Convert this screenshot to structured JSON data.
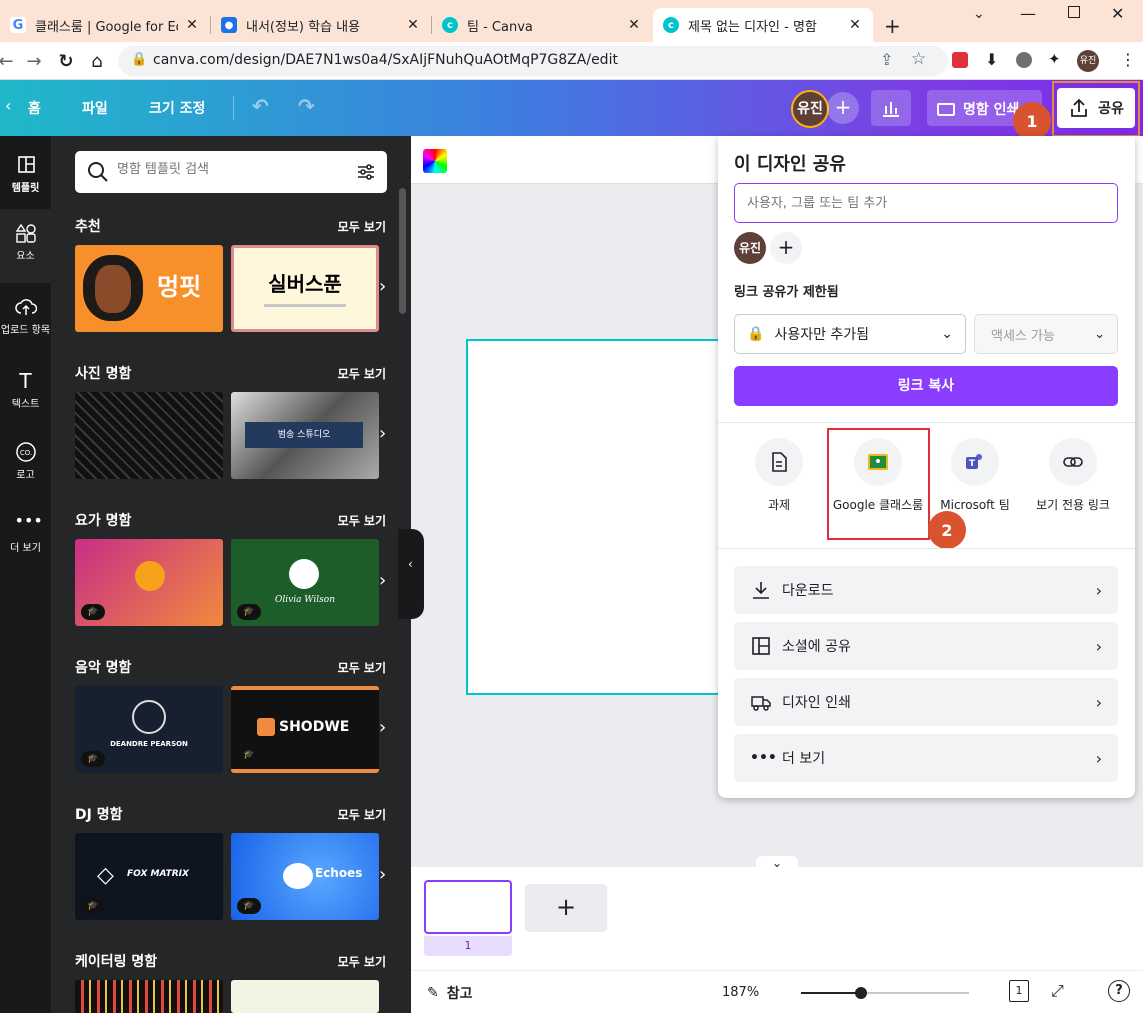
{
  "browser": {
    "tabs": [
      {
        "title": "클래스룸 | Google for Educat",
        "icon": "google-icon",
        "color": "#4285f4"
      },
      {
        "title": "내서(정보) 학습 내용",
        "icon": "contacts-icon",
        "color": "#1a73e8"
      },
      {
        "title": "팀 - Canva",
        "icon": "canva-icon",
        "color": "#00c4cc"
      },
      {
        "title": "제목 없는 디자인 - 명함",
        "icon": "canva-icon",
        "color": "#00c4cc"
      }
    ],
    "url": "canva.com/design/DAE7N1ws0a4/SxAIjFNuhQuAOtMqP7G8ZA/edit",
    "profile": "유진"
  },
  "header": {
    "home": "홈",
    "file": "파일",
    "resize": "크기 조정",
    "avatar": "유진",
    "print": "명함 인쇄",
    "share": "공유"
  },
  "rail": [
    {
      "label": "템플릿",
      "icon": "template-icon"
    },
    {
      "label": "요소",
      "icon": "elements-icon"
    },
    {
      "label": "업로드 항목",
      "icon": "upload-icon"
    },
    {
      "label": "텍스트",
      "icon": "text-icon"
    },
    {
      "label": "로고",
      "icon": "logo-icon"
    },
    {
      "label": "더 보기",
      "icon": "more-icon"
    }
  ],
  "panel": {
    "search_placeholder": "명함 템플릿 검색",
    "see_all": "모두 보기",
    "sections": [
      "추천",
      "사진 명함",
      "요가 명함",
      "음악 명함",
      "DJ 명함",
      "케이터링 명함"
    ],
    "thumb_texts": {
      "dog": "멍핏",
      "silver": "실버스푼",
      "studio": "범송 스튜디오",
      "shodwe": "SHODWE",
      "deandre": "DEANDRE PEARSON",
      "fox": "FOX MATRIX",
      "echoes": "Echoes",
      "olivia": "Olivia Wilson"
    }
  },
  "share": {
    "title": "이 디자인 공유",
    "people_placeholder": "사용자, 그룹 또는 팀 추가",
    "avatar": "유진",
    "link_status": "링크 공유가 제한됨",
    "access_select": "사용자만 추가됨",
    "access_level": "액세스 가능",
    "copy_link": "링크 복사",
    "apps": [
      {
        "label": "과제",
        "icon": "assignment-icon"
      },
      {
        "label": "Google 클래스룸",
        "icon": "google-classroom-icon"
      },
      {
        "label": "Microsoft 팀",
        "icon": "microsoft-teams-icon"
      },
      {
        "label": "보기 전용 링크",
        "icon": "link-icon"
      }
    ],
    "rows": [
      {
        "label": "다운로드",
        "icon": "download-icon"
      },
      {
        "label": "소셜에 공유",
        "icon": "social-icon"
      },
      {
        "label": "디자인 인쇄",
        "icon": "truck-icon"
      },
      {
        "label": "더 보기",
        "icon": "more-dots-icon"
      }
    ]
  },
  "badges": [
    "1",
    "2"
  ],
  "footer": {
    "notes": "참고",
    "zoom": "187%",
    "page_number": "1",
    "zoom_fraction": 0.36
  },
  "colors": {
    "accent": "#8b3dff",
    "badge": "#d9532f",
    "highlight": "#e0313a"
  }
}
